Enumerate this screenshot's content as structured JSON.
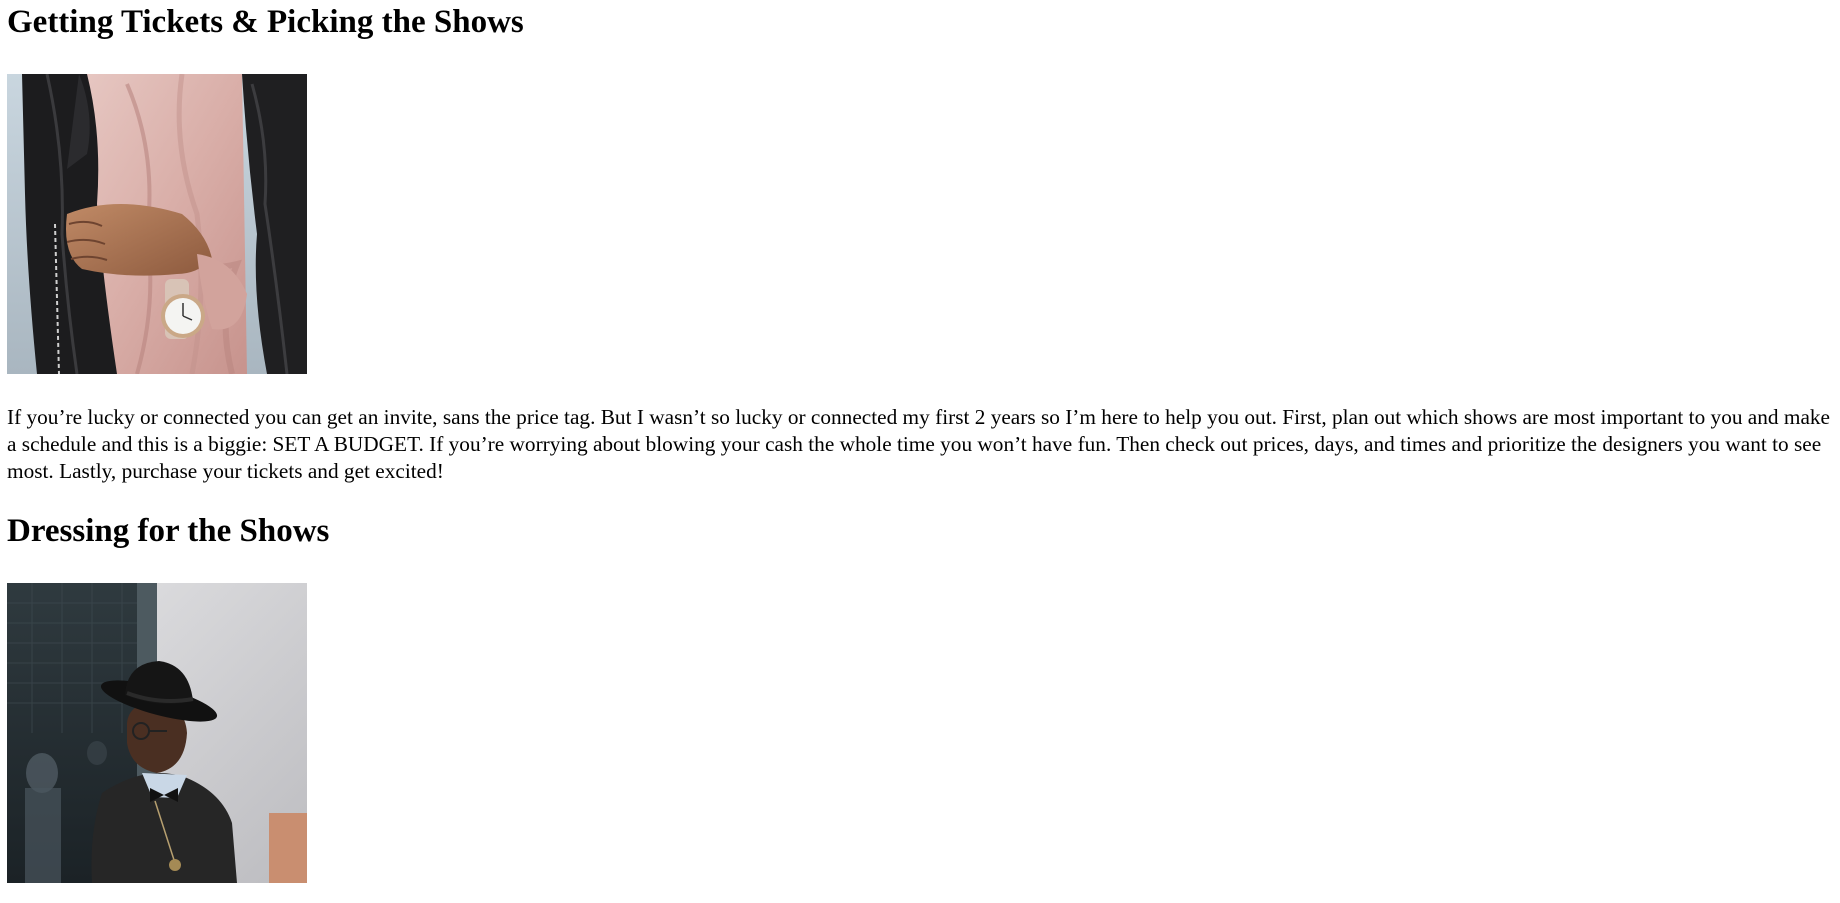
{
  "sections": [
    {
      "heading": "Getting Tickets & Picking the Shows",
      "image_subject": "person-in-leather-jacket-with-watch",
      "paragraph": "If you’re lucky or connected you can get an invite, sans the price tag. But I wasn’t so lucky or connected my first 2 years so I’m here to help you out. First, plan out which shows are most important to you and make a schedule and this is a biggie: SET A BUDGET. If you’re worrying about blowing your cash the whole time you won’t have fun. Then check out prices, days, and times and prioritize the designers you want to see most. Lastly, purchase your tickets and get excited!"
    },
    {
      "heading": "Dressing for the Shows",
      "image_subject": "man-in-black-hat-and-bow-tie"
    }
  ],
  "colors": {
    "text": "#000000",
    "background": "#ffffff"
  }
}
